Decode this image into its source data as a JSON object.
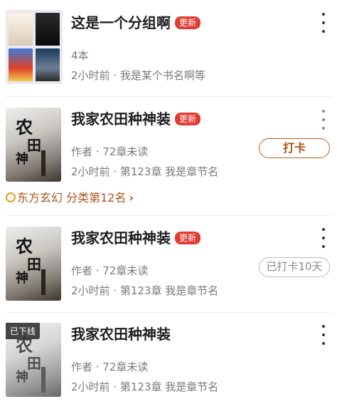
{
  "group": {
    "title": "这是一个分组啊",
    "badge": "更新",
    "count": "4本",
    "info": "2小时前 · 我是某个书名啊等"
  },
  "books": [
    {
      "title": "我家农田种神装",
      "badge": "更新",
      "author_line": "作者 · 72章未读",
      "update_line": "2小时前 · 第123章 我是章节名",
      "action": "打卡",
      "cover_text": "农田种神装"
    },
    {
      "title": "我家农田种神装",
      "badge": "更新",
      "author_line": "作者 · 72章未读",
      "update_line": "2小时前 · 第123章 我是章节名",
      "action": "已打卡10天",
      "cover_text": "农田种神装"
    },
    {
      "title": "我家农田种神装",
      "author_line": "作者 · 72章未读",
      "update_line": "2小时前 · 第123章 我是章节名",
      "status": "已下线",
      "cover_text": "农田种神装"
    }
  ],
  "category_rank": "东方玄幻 分类第12名",
  "icons": {
    "more": "more-vertical-icon",
    "medal": "medal-icon",
    "chevron": "chevron-right-icon"
  },
  "colors": {
    "badge": "#e23b32",
    "checkin": "#c0601f",
    "category": "#b0541a"
  }
}
